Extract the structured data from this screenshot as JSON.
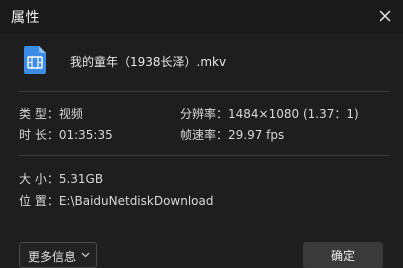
{
  "dialog": {
    "title": "属性",
    "close_icon": "close-icon"
  },
  "file": {
    "icon": "video-file-icon",
    "icon_color": "#3b8de6",
    "name": "我的童年（1938长泽）.mkv"
  },
  "properties": {
    "type": "类 型：视频",
    "resolution": "分辨率：1484×1080 (1.37：1)",
    "duration": "时 长：01:35:35",
    "frame_rate": "帧速率：29.97 fps",
    "size": "大 小：5.31GB",
    "location": "位 置：E:\\BaiduNetdiskDownload"
  },
  "footer": {
    "more_info_label": "更多信息",
    "more_info_icon": "chevron-down-icon",
    "ok_label": "确定"
  }
}
